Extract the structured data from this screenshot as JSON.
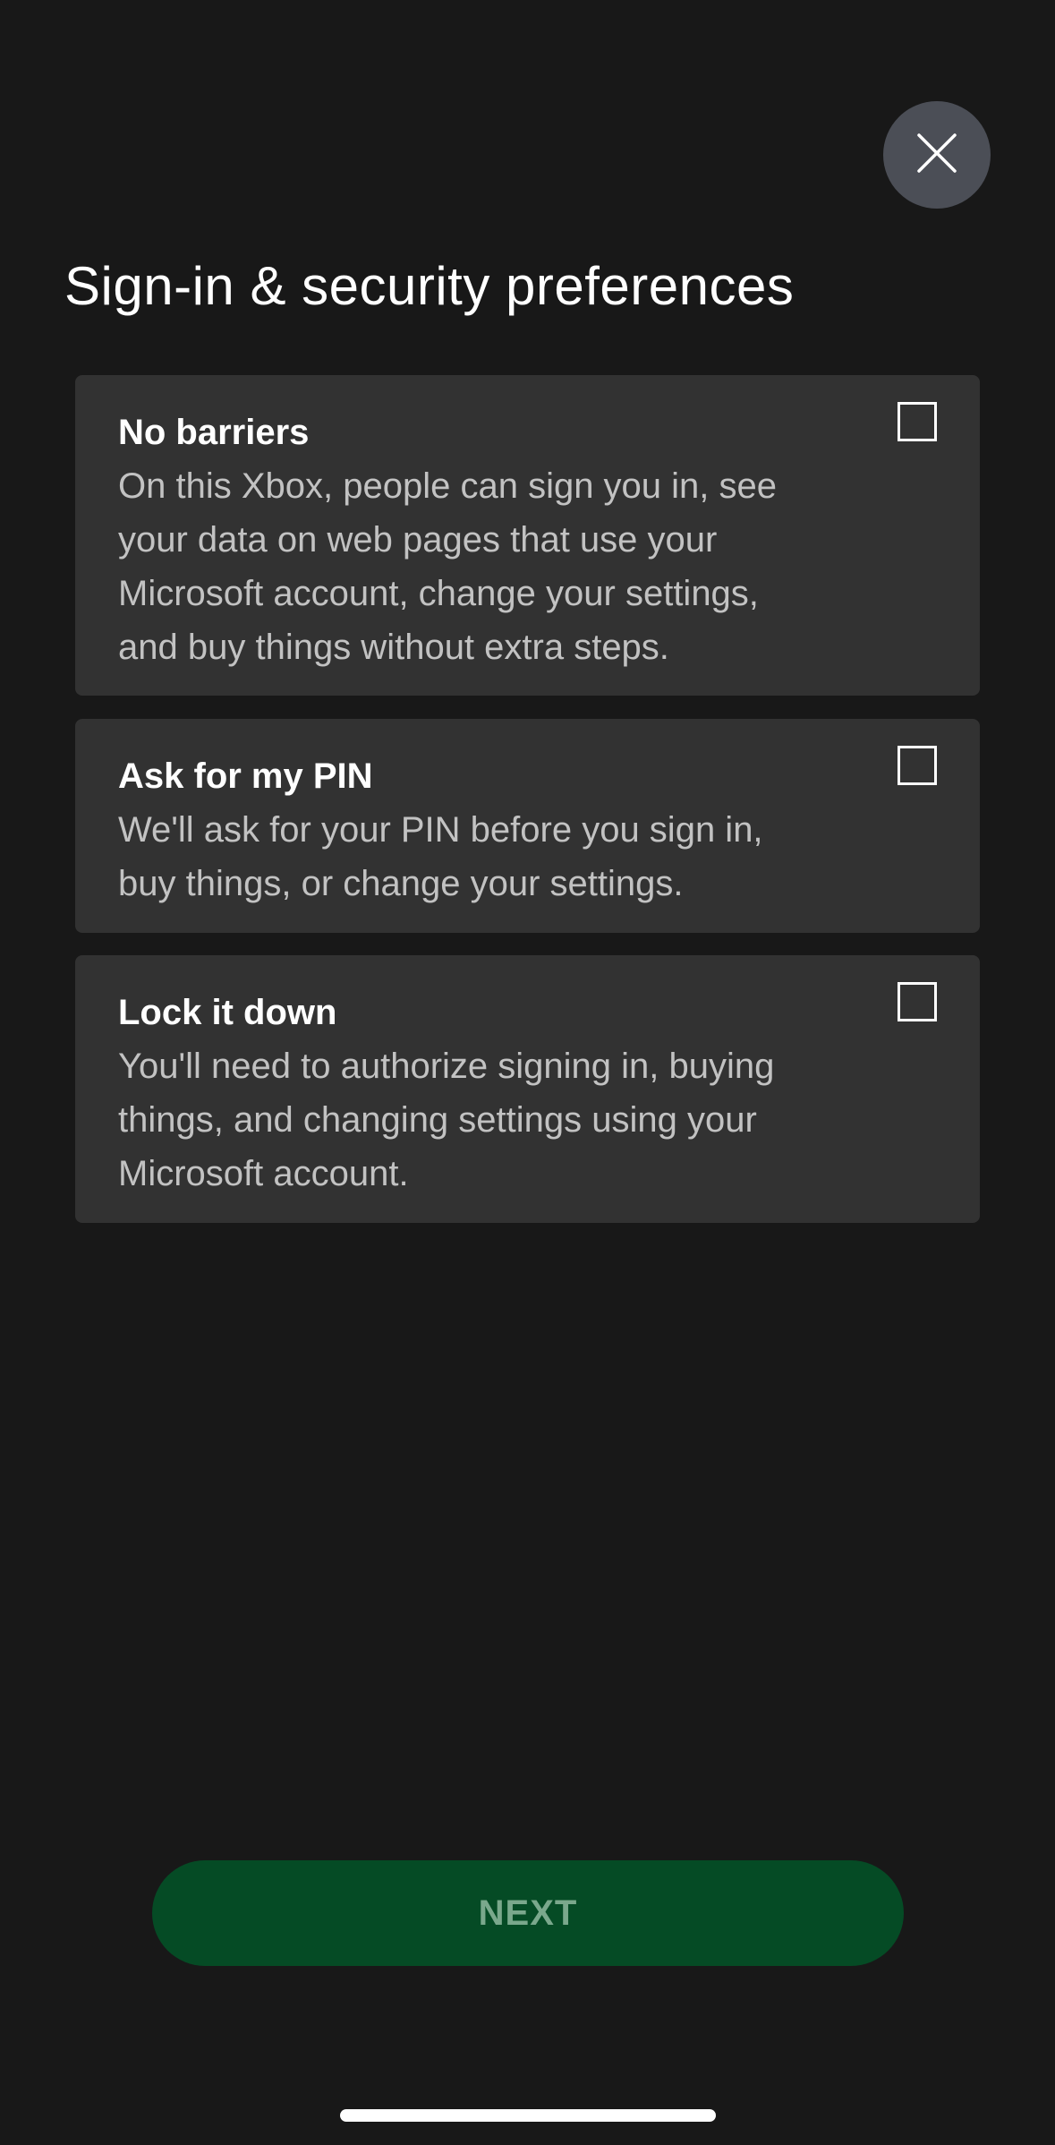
{
  "header": {
    "close_icon": "close-icon",
    "title": "Sign-in & security preferences"
  },
  "options": [
    {
      "title": "No barriers",
      "description": "On this Xbox, people can sign you in, see your data on web pages that use your Microsoft account, change your settings, and buy things without extra steps.",
      "checked": false
    },
    {
      "title": "Ask for my PIN",
      "description": "We'll ask for your PIN before you sign in, buy things, or change your settings.",
      "checked": false
    },
    {
      "title": "Lock it down",
      "description": "You'll need to authorize signing in, buying things, and changing settings using your Microsoft account.",
      "checked": false
    }
  ],
  "footer": {
    "next_label": "NEXT"
  },
  "colors": {
    "background": "#181818",
    "card": "#323232",
    "close_button": "#4b4e56",
    "next_button": "#054b25",
    "next_label": "#7aa88c"
  }
}
